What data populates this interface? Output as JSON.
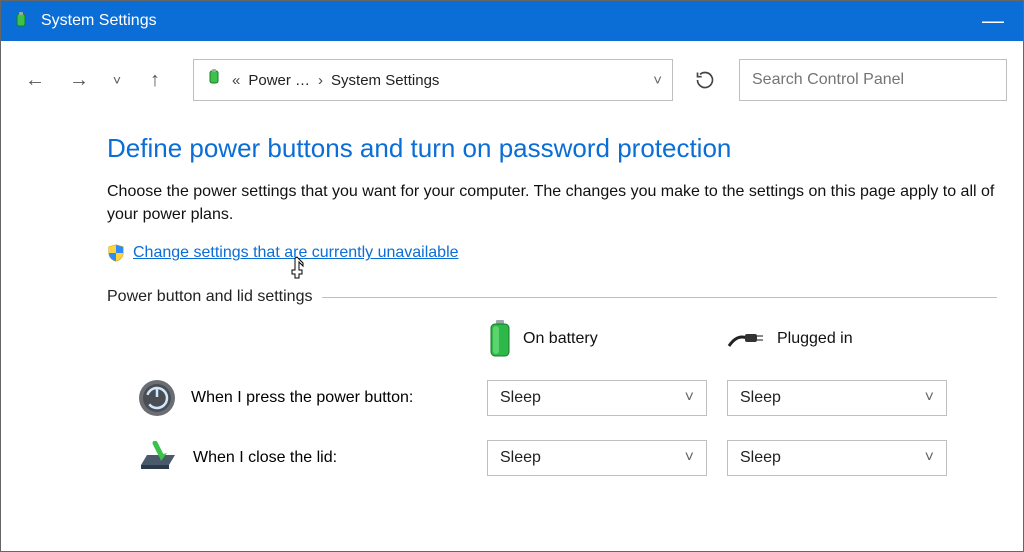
{
  "titlebar": {
    "title": "System Settings"
  },
  "nav": {
    "breadcrumb_prefix": "«",
    "crumb1": "Power …",
    "sep": "›",
    "crumb2": "System Settings"
  },
  "search": {
    "placeholder": "Search Control Panel"
  },
  "heading": "Define power buttons and turn on password protection",
  "description": "Choose the power settings that you want for your computer. The changes you make to the settings on this page apply to all of your power plans.",
  "change_link": "Change settings that are currently unavailable",
  "section_label": "Power button and lid settings",
  "columns": {
    "battery": "On battery",
    "plugged": "Plugged in"
  },
  "rows": {
    "power_button": {
      "label": "When I press the power button:",
      "battery_value": "Sleep",
      "plugged_value": "Sleep"
    },
    "close_lid": {
      "label": "When I close the lid:",
      "battery_value": "Sleep",
      "plugged_value": "Sleep"
    }
  }
}
